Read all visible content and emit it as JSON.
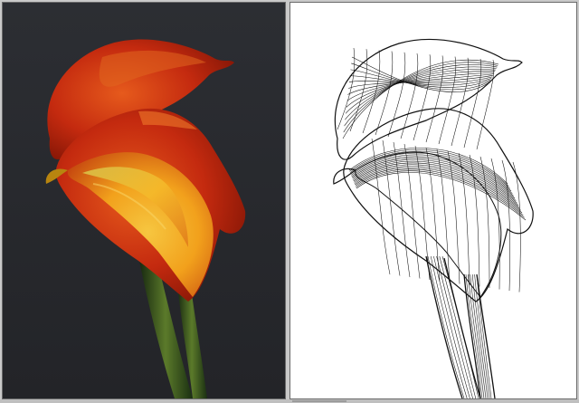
{
  "canvas": {
    "left_background": "#2a2c30",
    "right_background": "#ffffff",
    "frame_color": "#6a6a6a",
    "wire_color": "#111111"
  },
  "artwork": {
    "subject": "calla-lily",
    "colors": {
      "outer_petal": "#c42a0f",
      "petal_highlight": "#e05a1a",
      "inner_throat": "#f2a11c",
      "throat_yellow": "#f6c640",
      "stem_dark": "#1f3a18",
      "stem_light": "#5b7a2a"
    }
  }
}
